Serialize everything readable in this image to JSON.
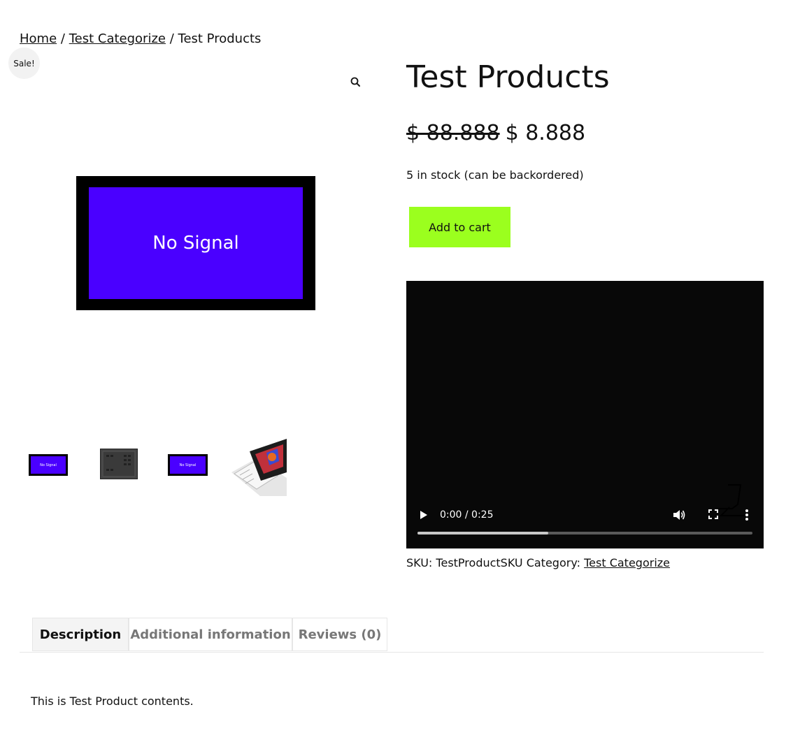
{
  "breadcrumb": {
    "home": "Home",
    "sep1": "/",
    "category": "Test Categorize",
    "sep2": "/",
    "current": "Test Products"
  },
  "gallery": {
    "sale_badge": "Sale!",
    "zoom_icon": "magnifier-icon",
    "main_image_text": "No Signal",
    "thumbnails": [
      {
        "name": "no-signal-screen",
        "text": "No Signal"
      },
      {
        "name": "black-panel"
      },
      {
        "name": "no-signal-screen",
        "text": "No Signal"
      },
      {
        "name": "tablet-device"
      }
    ]
  },
  "product": {
    "title": "Test Products",
    "old_price": "$ 88.888",
    "new_price": "$ 8.888",
    "stock": "5 in stock (can be backordered)",
    "add_to_cart": "Add to cart"
  },
  "video": {
    "time": "0:00 / 0:25",
    "progress": 0.39
  },
  "meta": {
    "sku_label": "SKU:",
    "sku": "TestProductSKU",
    "category_label": "Category:",
    "category": "Test Categorize"
  },
  "tabs": [
    {
      "label": "Description",
      "active": true
    },
    {
      "label": "Additional information",
      "active": false
    },
    {
      "label": "Reviews (0)",
      "active": false
    }
  ],
  "description": "This is Test Product contents.",
  "colors": {
    "accent_button": "#9bff1e",
    "screen_blue": "#4a00ff",
    "video_bg": "#080808"
  }
}
